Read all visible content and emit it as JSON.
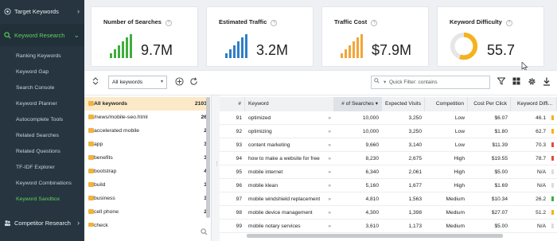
{
  "sidebar": {
    "sections": [
      {
        "label": "Target Keywords",
        "chevron": "›",
        "icon": "target-icon"
      },
      {
        "label": "Keyword Research",
        "chevron": "⌄",
        "icon": "search-icon"
      },
      {
        "label": "Competitor Research",
        "chevron": "›",
        "icon": "people-icon"
      }
    ],
    "items": [
      {
        "label": "Ranking Keywords"
      },
      {
        "label": "Keyword Gap"
      },
      {
        "label": "Search Console"
      },
      {
        "label": "Keyword Planner"
      },
      {
        "label": "Autocomplete Tools"
      },
      {
        "label": "Related Searches"
      },
      {
        "label": "Related Questions"
      },
      {
        "label": "TF-IDF Explorer"
      },
      {
        "label": "Keyword Combinations"
      },
      {
        "label": "Keyword Sandbox"
      }
    ]
  },
  "cards": [
    {
      "title": "Number of Searches",
      "help": "?",
      "value": "9.7M",
      "color": "#3fae3a",
      "icon": "bar-chart-icon"
    },
    {
      "title": "Estimated Traffic",
      "help": "?",
      "value": "3.2M",
      "color": "#2f7fc8",
      "icon": "bar-chart-icon"
    },
    {
      "title": "Traffic Cost",
      "help": "?",
      "value": "$7.9M",
      "color": "#f3a53a",
      "icon": "bar-chart-icon"
    },
    {
      "title": "Keyword Difficulty",
      "help": "?",
      "value": "55.7",
      "color": "#f5b21c",
      "difficulty": 55.7,
      "icon": "donut-gauge-icon"
    }
  ],
  "toolbar": {
    "collapse_icon": "expand-collapse-icon",
    "select_value": "All keywords",
    "add_icon": "add-circle-icon",
    "refresh_icon": "refresh-icon",
    "quick_filter_placeholder": "Quick Filter: contains",
    "filter_icon": "funnel-icon",
    "columns_icon": "grid-icon",
    "settings_icon": "gear-icon",
    "export_icon": "download-icon"
  },
  "tree": [
    {
      "name": "All keywords",
      "count": "2103"
    },
    {
      "name": "/news/mobile-seo.html",
      "count": "26"
    },
    {
      "name": "accelerated mobile",
      "count": "2"
    },
    {
      "name": "app",
      "count": "3"
    },
    {
      "name": "benefits",
      "count": "3"
    },
    {
      "name": "bootstrap",
      "count": "4"
    },
    {
      "name": "build",
      "count": "3"
    },
    {
      "name": "business",
      "count": "3"
    },
    {
      "name": "cell phone",
      "count": "2"
    },
    {
      "name": "check",
      "count": ""
    }
  ],
  "grid": {
    "headers": [
      "#",
      "Keyword",
      "# of Searches ▾",
      "Expected Visits",
      "Competition",
      "Cost Per Click",
      "Keyword Diffi..."
    ],
    "rows": [
      {
        "num": "91",
        "keyword": "optimized",
        "searches": "10,000",
        "visits": "3,250",
        "competition": "Low",
        "cpc": "$6.07",
        "kd": "46.1",
        "kd_color": "#f5b21c"
      },
      {
        "num": "92",
        "keyword": "optimizing",
        "searches": "10,000",
        "visits": "3,250",
        "competition": "Low",
        "cpc": "$1.80",
        "kd": "62.7",
        "kd_color": "#f5b21c"
      },
      {
        "num": "93",
        "keyword": "content marketing",
        "searches": "9,660",
        "visits": "3,140",
        "competition": "Low",
        "cpc": "$11.39",
        "kd": "70.3",
        "kd_color": "#e84a3a"
      },
      {
        "num": "94",
        "keyword": "how to make a website for free",
        "searches": "8,230",
        "visits": "2,675",
        "competition": "High",
        "cpc": "$19.55",
        "kd": "78.7",
        "kd_color": "#e84a3a"
      },
      {
        "num": "95",
        "keyword": "mobile internet",
        "searches": "6,340",
        "visits": "2,061",
        "competition": "High",
        "cpc": "$5.00",
        "kd": "N/A",
        "kd_color": "#dddddd"
      },
      {
        "num": "96",
        "keyword": "mobile klean",
        "searches": "5,160",
        "visits": "1,677",
        "competition": "High",
        "cpc": "$1.69",
        "kd": "N/A",
        "kd_color": "#dddddd"
      },
      {
        "num": "97",
        "keyword": "mobile windshield replacement",
        "searches": "4,810",
        "visits": "1,563",
        "competition": "Medium",
        "cpc": "$10.34",
        "kd": "26.2",
        "kd_color": "#3fae3a"
      },
      {
        "num": "98",
        "keyword": "mobile device management",
        "searches": "4,300",
        "visits": "1,398",
        "competition": "Medium",
        "cpc": "$27.07",
        "kd": "51.2",
        "kd_color": "#f5b21c"
      },
      {
        "num": "99",
        "keyword": "mobile notary services",
        "searches": "3,610",
        "visits": "1,173",
        "competition": "Medium",
        "cpc": "$5.00",
        "kd": "N/A",
        "kd_color": "#dddddd"
      }
    ]
  },
  "row_action": "»"
}
